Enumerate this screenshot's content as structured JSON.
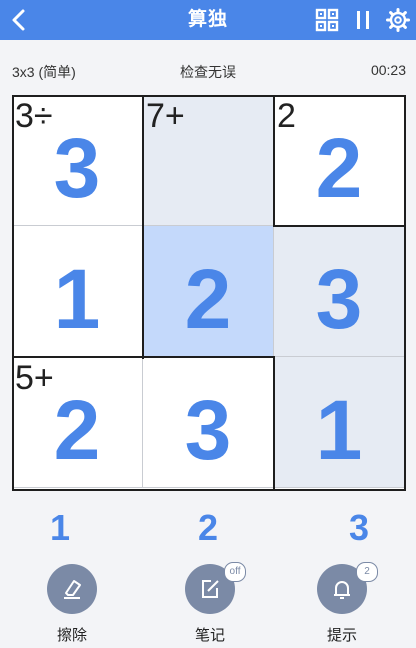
{
  "header": {
    "title": "算独"
  },
  "status": {
    "difficulty": "3x3 (简单)",
    "check": "检查无误",
    "timer": "00:23"
  },
  "colors": {
    "accent": "#4a86e8",
    "cell_default": "#ffffff",
    "cell_shaded": "#e6ebf3",
    "cell_selected": "#c4d9fb",
    "tool_circle": "#7b8aa6"
  },
  "board": {
    "rows": [
      [
        {
          "value": "3",
          "cage": "3÷",
          "shade": "default"
        },
        {
          "value": "",
          "cage": "7+",
          "shade": "shaded"
        },
        {
          "value": "2",
          "cage": "2",
          "shade": "default"
        }
      ],
      [
        {
          "value": "1",
          "cage": "",
          "shade": "default"
        },
        {
          "value": "2",
          "cage": "",
          "shade": "selected"
        },
        {
          "value": "3",
          "cage": "",
          "shade": "shaded"
        }
      ],
      [
        {
          "value": "2",
          "cage": "5+",
          "shade": "default"
        },
        {
          "value": "3",
          "cage": "",
          "shade": "default"
        },
        {
          "value": "1",
          "cage": "",
          "shade": "shaded"
        }
      ]
    ]
  },
  "numpad": [
    "1",
    "2",
    "3"
  ],
  "tools": {
    "erase": {
      "label": "擦除",
      "icon": "eraser-icon"
    },
    "notes": {
      "label": "笔记",
      "icon": "edit-note-icon",
      "badge": "off"
    },
    "hint": {
      "label": "提示",
      "icon": "bulb-icon",
      "badge": "2"
    }
  }
}
